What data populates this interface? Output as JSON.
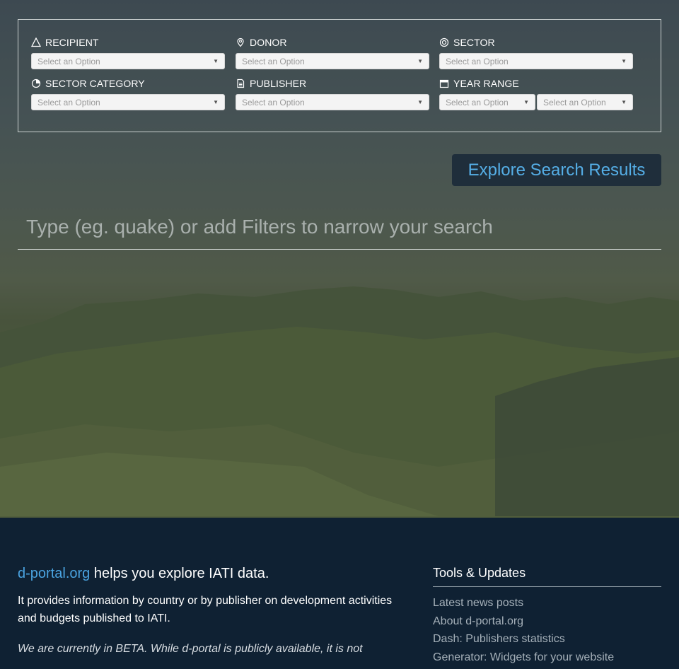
{
  "filters": {
    "recipient": {
      "label": "RECIPIENT",
      "placeholder": "Select an Option",
      "icon": "triangle-icon"
    },
    "donor": {
      "label": "DONOR",
      "placeholder": "Select an Option",
      "icon": "location-pin-icon"
    },
    "sector": {
      "label": "SECTOR",
      "placeholder": "Select an Option",
      "icon": "target-icon"
    },
    "sector_category": {
      "label": "SECTOR CATEGORY",
      "placeholder": "Select an Option",
      "icon": "pie-chart-icon"
    },
    "publisher": {
      "label": "PUBLISHER",
      "placeholder": "Select an Option",
      "icon": "document-icon"
    },
    "year_range": {
      "label": "YEAR RANGE",
      "from_placeholder": "Select an Option",
      "to_placeholder": "Select an Option",
      "icon": "calendar-icon"
    }
  },
  "explore_button": "Explore Search Results",
  "search": {
    "placeholder": "Type (eg. quake) or add Filters to narrow your search"
  },
  "footer": {
    "brand": "d-portal.org",
    "tagline_rest": " helps you explore IATI data.",
    "description": "It provides information by country or by publisher on development activities and budgets published to IATI.",
    "beta": "We are currently in BETA. While d-portal is publicly available, it is not",
    "tools_title": "Tools & Updates",
    "tools": [
      "Latest news posts",
      "About d-portal.org",
      "Dash: Publishers statistics",
      "Generator: Widgets for your website"
    ]
  },
  "colors": {
    "accent": "#55aee6",
    "button_bg": "#1f2e3b",
    "footer_bg": "#0f2133"
  }
}
